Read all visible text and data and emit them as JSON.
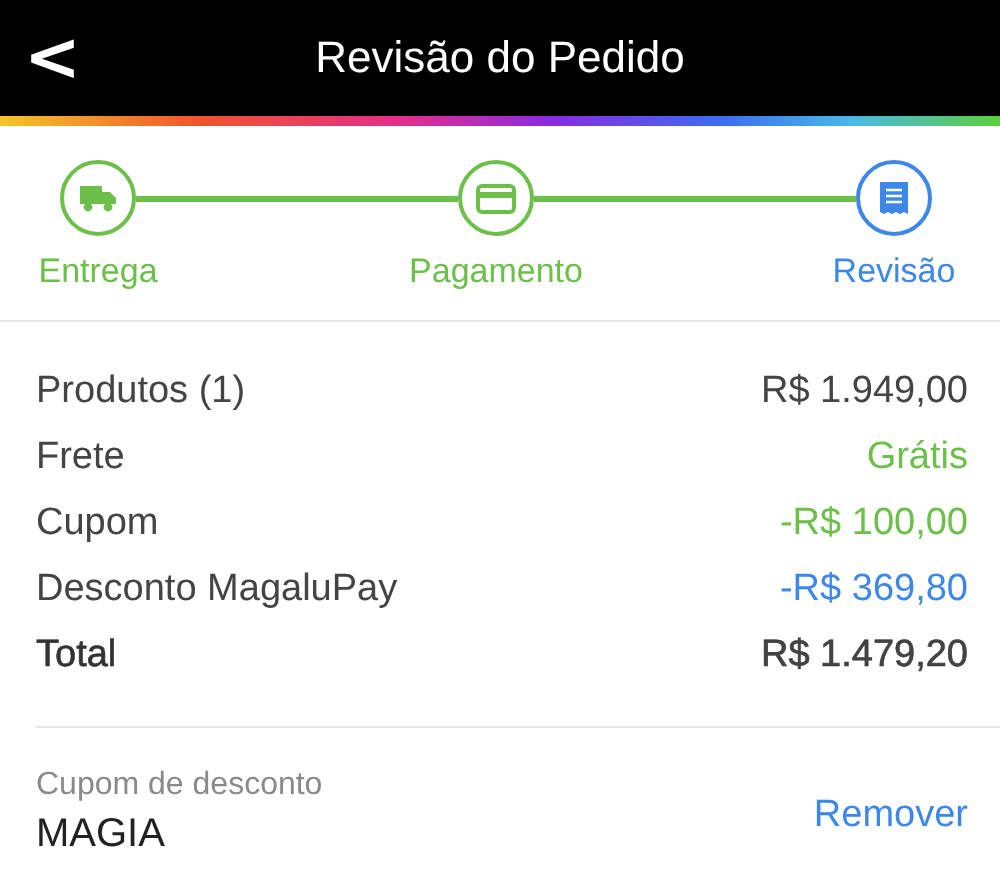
{
  "header": {
    "back": "<",
    "title": "Revisão do Pedido"
  },
  "steps": [
    {
      "label": "Entrega",
      "kind": "truck",
      "selected": false
    },
    {
      "label": "Pagamento",
      "kind": "card",
      "selected": false
    },
    {
      "label": "Revisão",
      "kind": "document",
      "selected": true
    }
  ],
  "summary": [
    {
      "kind": "line",
      "label": "Produtos (1)",
      "value": "R$ 1.949,00",
      "color": "#444444"
    },
    {
      "kind": "line",
      "label": "Frete",
      "value": "Grátis",
      "color": "#6cc04a"
    },
    {
      "kind": "line",
      "label": "Cupom",
      "value": "-R$ 100,00",
      "color": "#6cc04a"
    },
    {
      "kind": "line",
      "label": "Desconto MagaluPay",
      "value": "-R$ 369,80",
      "color": "#3c87e8"
    },
    {
      "kind": "total",
      "label": "Total",
      "value": "R$ 1.479,20",
      "color": "#444444"
    }
  ],
  "coupon": {
    "label": "Cupom de desconto",
    "code": "MAGIA",
    "action": "Remover"
  }
}
